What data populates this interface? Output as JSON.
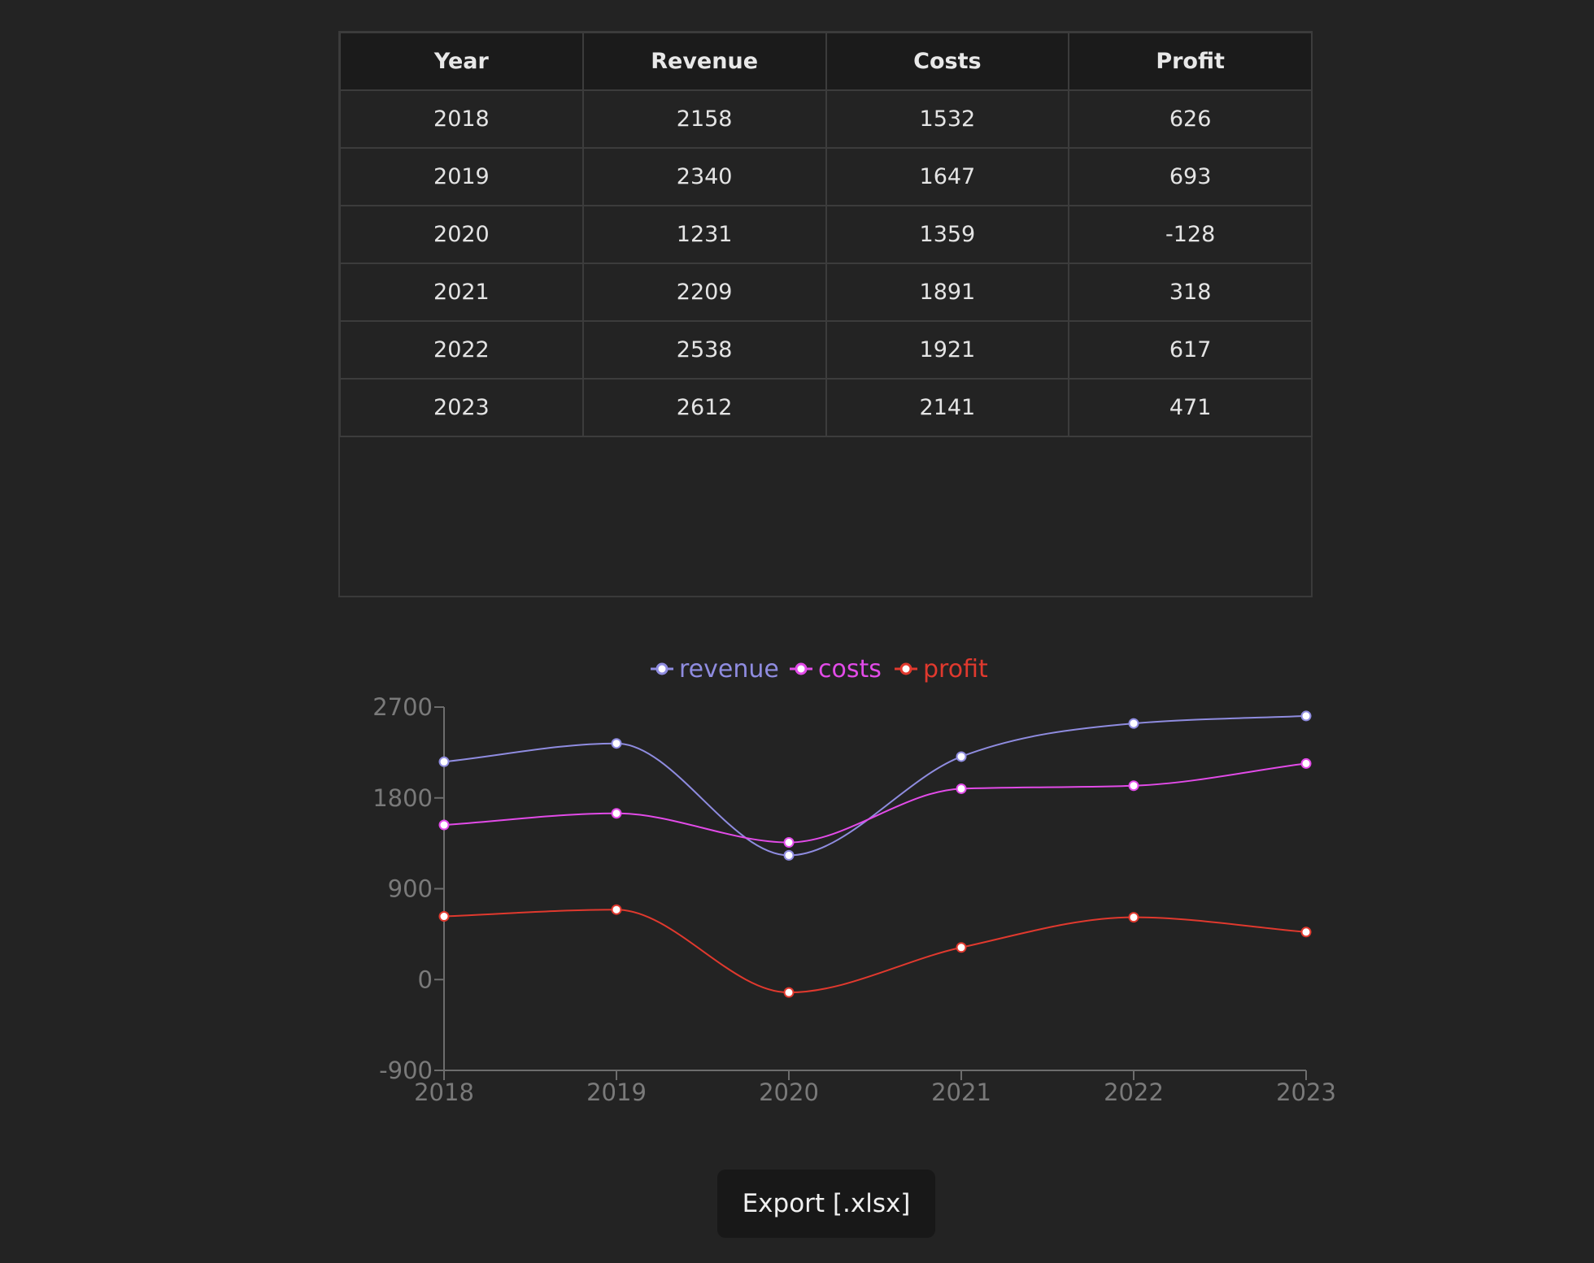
{
  "table": {
    "headers": [
      "Year",
      "Revenue",
      "Costs",
      "Profit"
    ],
    "rows": [
      [
        "2018",
        "2158",
        "1532",
        "626"
      ],
      [
        "2019",
        "2340",
        "1647",
        "693"
      ],
      [
        "2020",
        "1231",
        "1359",
        "-128"
      ],
      [
        "2021",
        "2209",
        "1891",
        "318"
      ],
      [
        "2022",
        "2538",
        "1921",
        "617"
      ],
      [
        "2023",
        "2612",
        "2141",
        "471"
      ]
    ]
  },
  "chart_data": {
    "type": "line",
    "x": [
      "2018",
      "2019",
      "2020",
      "2021",
      "2022",
      "2023"
    ],
    "series": [
      {
        "name": "revenue",
        "color": "#8f8ce0",
        "values": [
          2158,
          2340,
          1231,
          2209,
          2538,
          2612
        ]
      },
      {
        "name": "costs",
        "color": "#e24be8",
        "values": [
          1532,
          1647,
          1359,
          1891,
          1921,
          2141
        ]
      },
      {
        "name": "profit",
        "color": "#e0392e",
        "values": [
          626,
          693,
          -128,
          318,
          617,
          471
        ]
      }
    ],
    "yticks": [
      -900,
      0,
      900,
      1800,
      2700
    ],
    "ylim": [
      -900,
      2700
    ],
    "legend_position": "top-center",
    "curve": "smooth",
    "grid": false
  },
  "export_button": {
    "label": "Export [.xlsx]"
  }
}
